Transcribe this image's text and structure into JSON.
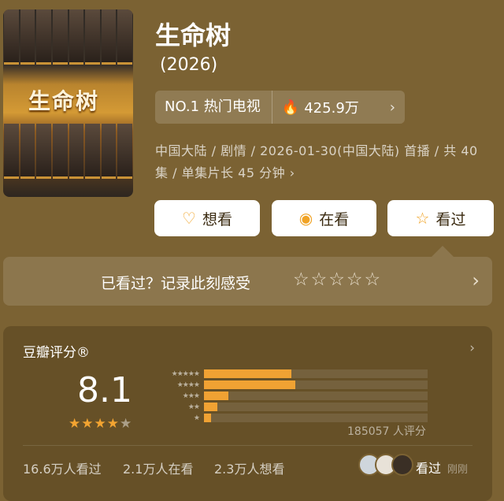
{
  "show": {
    "title": "生命树",
    "year": "(2026)",
    "rank": "NO.1 热门电视",
    "heat": "425.9万",
    "meta": "中国大陆 / 剧情 / 2026-01-30(中国大陆) 首播 / 共 40 集 / 单集片长 45 分钟",
    "poster_title": "生命树"
  },
  "actions": {
    "want": "想看",
    "watching": "在看",
    "watched": "看过"
  },
  "rate_prompt": {
    "text": "已看过？记录此刻感受",
    "stars": "☆☆☆☆☆"
  },
  "rating": {
    "title": "豆瓣评分®",
    "score": "8.1",
    "stars_filled": 4,
    "stars_total": 5,
    "count": "185057 人评分",
    "distribution": [
      {
        "label": "★★★★★",
        "fraction": 0.39
      },
      {
        "label": "★★★★",
        "fraction": 0.41
      },
      {
        "label": "★★★",
        "fraction": 0.11
      },
      {
        "label": "★★",
        "fraction": 0.06
      },
      {
        "label": "★",
        "fraction": 0.03
      }
    ]
  },
  "footer": {
    "watched_count": "16.6万人看过",
    "watching_count": "2.1万人在看",
    "want_count": "2.3万人想看",
    "friends_status": "看过",
    "friends_time": "刚刚"
  },
  "colors": {
    "accent": "#f0a233",
    "background": "#7b6233"
  }
}
